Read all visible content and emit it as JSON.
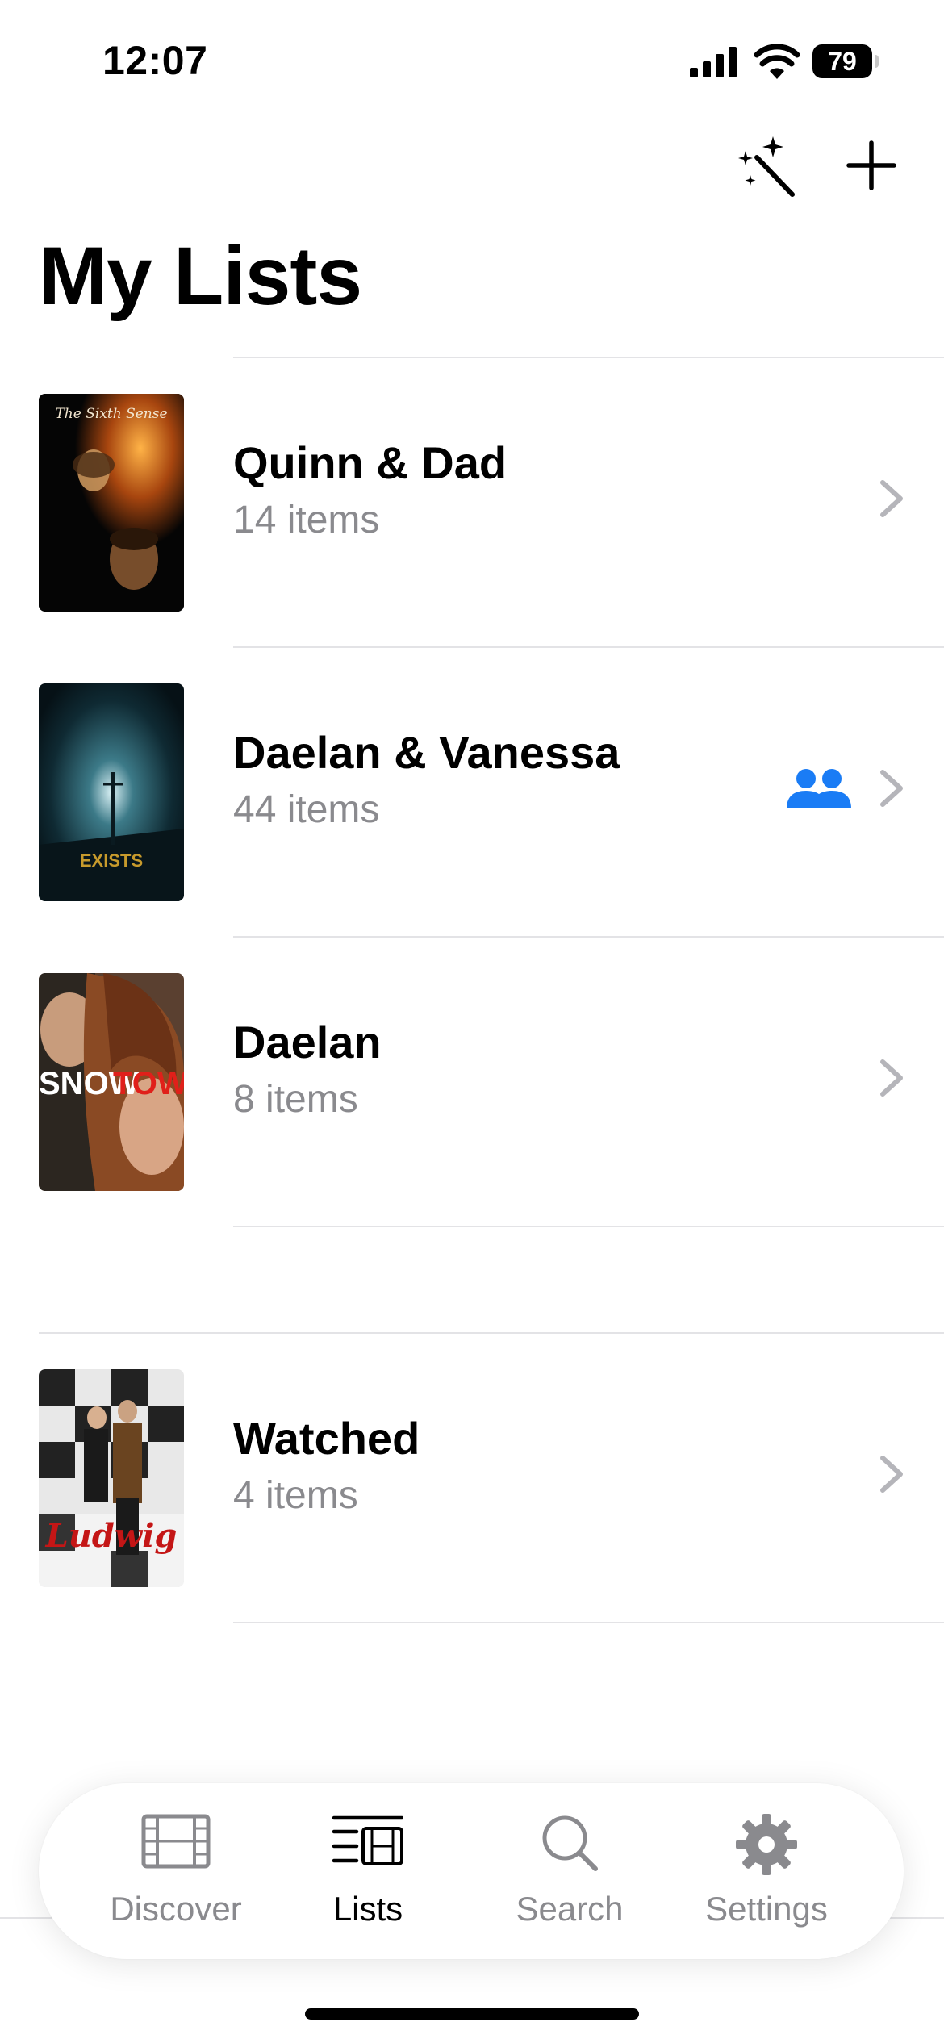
{
  "status_bar": {
    "time": "12:07",
    "battery": "79"
  },
  "toolbar": {
    "magic_icon": "magic-wand-icon",
    "add_icon": "plus-icon"
  },
  "page": {
    "title": "My Lists"
  },
  "lists": [
    {
      "name": "Quinn & Dad",
      "count": "14 items",
      "shared": false,
      "poster_text": "The Sixth Sense"
    },
    {
      "name": "Daelan & Vanessa",
      "count": "44 items",
      "shared": true,
      "poster_text": "EXISTS"
    },
    {
      "name": "Daelan",
      "count": "8 items",
      "shared": false,
      "poster_text_a": "SNOW",
      "poster_text_b": "TOWN"
    },
    {
      "name": "Watched",
      "count": "4 items",
      "shared": false,
      "poster_text": "Ludwig"
    }
  ],
  "tab_bar": {
    "tabs": [
      {
        "label": "Discover",
        "icon": "film-icon",
        "active": false
      },
      {
        "label": "Lists",
        "icon": "list-film-icon",
        "active": true
      },
      {
        "label": "Search",
        "icon": "search-icon",
        "active": false
      },
      {
        "label": "Settings",
        "icon": "gear-icon",
        "active": false
      }
    ]
  },
  "colors": {
    "accent": "#1a7cf5",
    "secondary_text": "#8a8a8e",
    "chevron": "#b5b5ba"
  }
}
